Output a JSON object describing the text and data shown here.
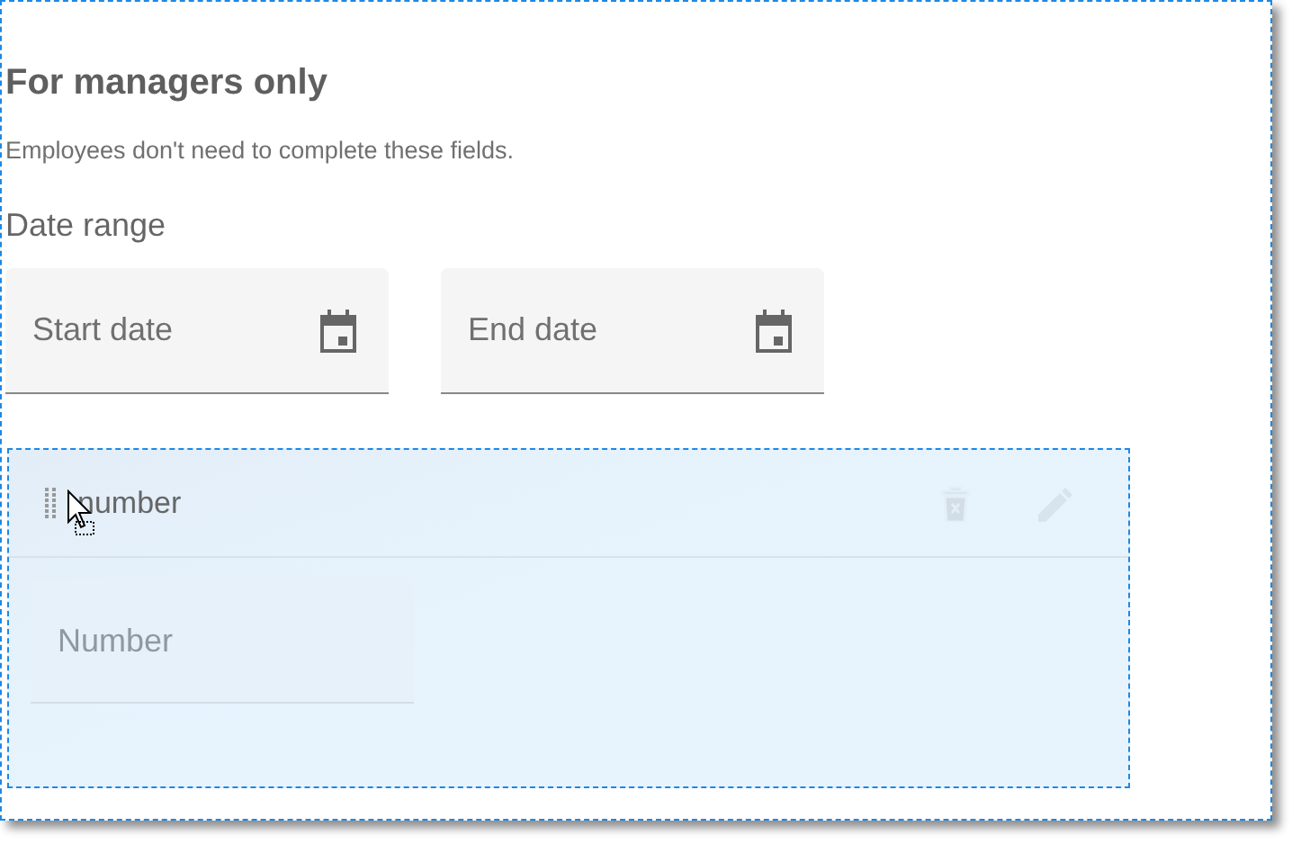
{
  "section": {
    "title": "For managers only",
    "description": "Employees  don't need to complete these fields."
  },
  "date_range": {
    "label": "Date range",
    "fields": [
      {
        "placeholder": "Start date"
      },
      {
        "placeholder": "End date"
      }
    ]
  },
  "dragged_field": {
    "title": "number",
    "placeholder": "Number"
  }
}
